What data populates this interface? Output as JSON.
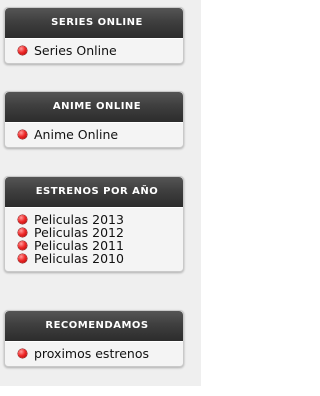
{
  "sidebar": {
    "boxes": [
      {
        "title": "SERIES ONLINE",
        "items": [
          {
            "label": "Series Online",
            "icon": "red-bullet-icon"
          }
        ]
      },
      {
        "title": "ANIME ONLINE",
        "items": [
          {
            "label": "Anime Online",
            "icon": "red-bullet-icon"
          }
        ]
      },
      {
        "title": "ESTRENOS POR AÑO",
        "items": [
          {
            "label": "Peliculas 2013",
            "icon": "red-bullet-icon"
          },
          {
            "label": "Peliculas 2012",
            "icon": "red-bullet-icon"
          },
          {
            "label": "Peliculas 2011",
            "icon": "red-bullet-icon"
          },
          {
            "label": "Peliculas 2010",
            "icon": "red-bullet-icon"
          }
        ]
      },
      {
        "title": "RECOMENDAMOS",
        "items": [
          {
            "label": "proximos estrenos",
            "icon": "red-bullet-icon"
          }
        ]
      }
    ]
  },
  "colors": {
    "header_background": "#3a3a3a",
    "header_text": "#ffffff",
    "box_background": "#f4f4f4",
    "bullet": "#e02020",
    "item_text": "#111111"
  }
}
